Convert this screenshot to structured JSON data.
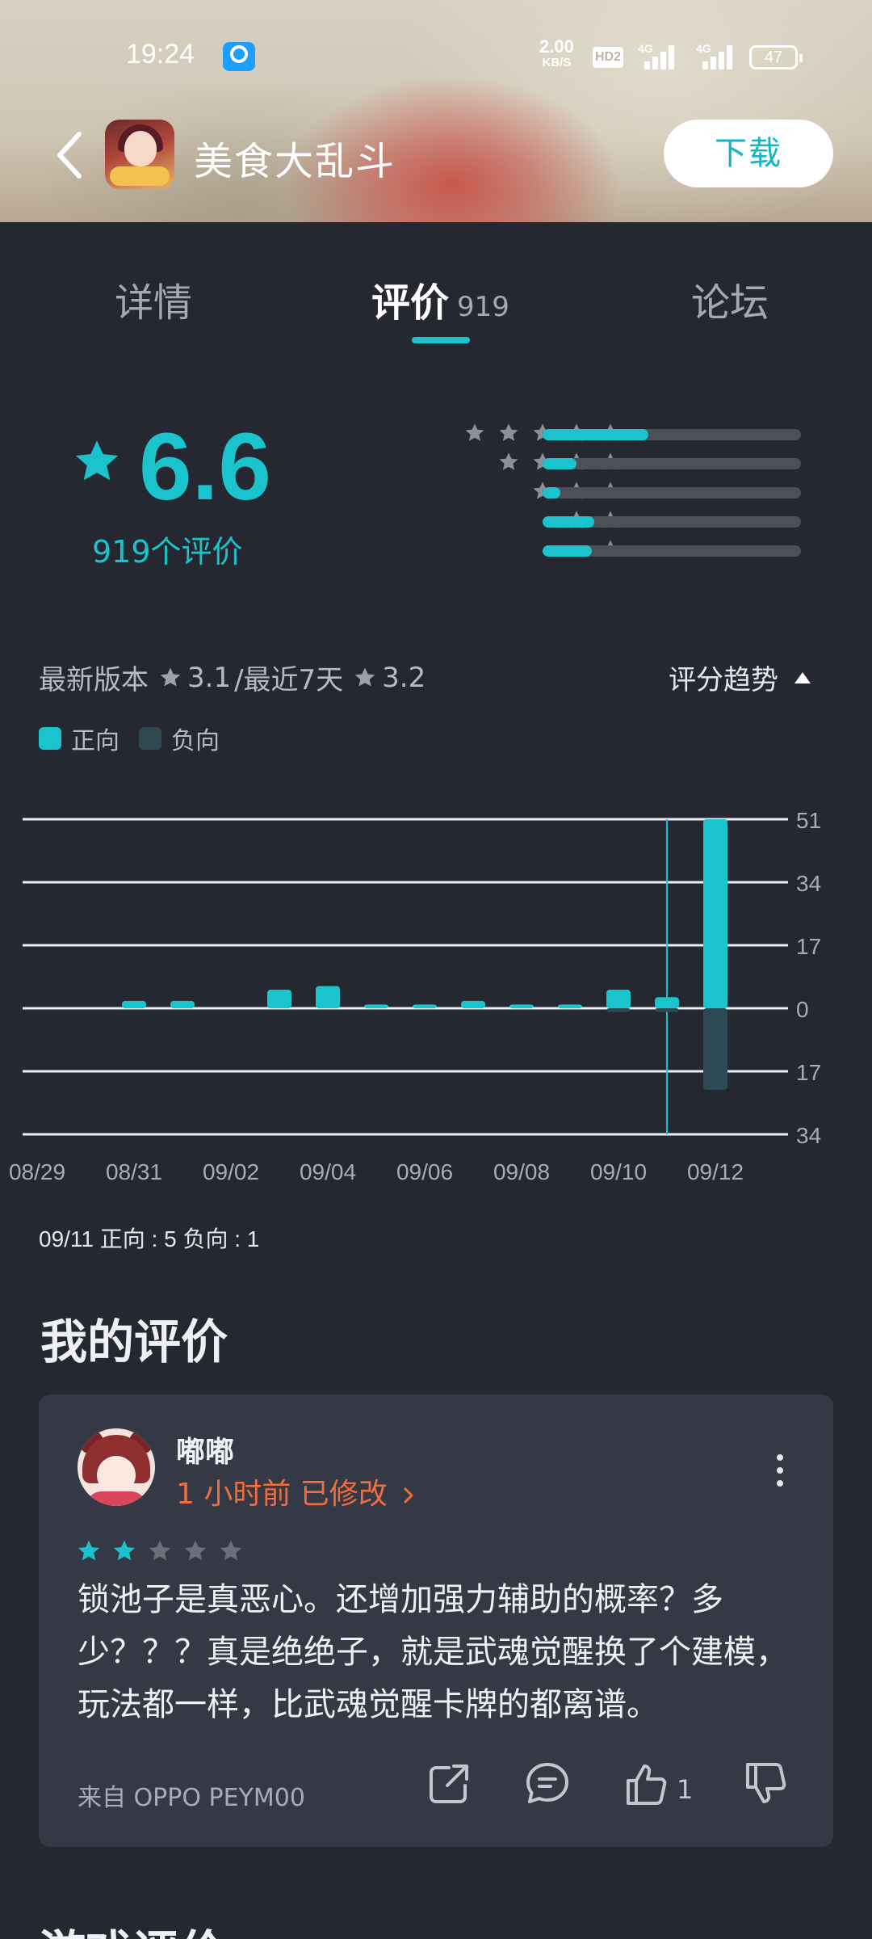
{
  "status_bar": {
    "time": "19:24",
    "speed_value": "2.00",
    "speed_unit": "KB/S",
    "hd_label": "HD2",
    "signal1_label": "4G",
    "signal2_label": "4G",
    "battery": "47"
  },
  "header": {
    "app_title": "美食大乱斗",
    "download_label": "下载"
  },
  "tabs": [
    {
      "label": "详情",
      "count": ""
    },
    {
      "label": "评价",
      "count": "919"
    },
    {
      "label": "论坛",
      "count": ""
    }
  ],
  "rating": {
    "score": "6.6",
    "count_label": "919个评价",
    "distribution": [
      {
        "stars": 5,
        "fraction": 0.41
      },
      {
        "stars": 4,
        "fraction": 0.13
      },
      {
        "stars": 3,
        "fraction": 0.07
      },
      {
        "stars": 2,
        "fraction": 0.2
      },
      {
        "stars": 1,
        "fraction": 0.19
      }
    ]
  },
  "version": {
    "latest_label": "最新版本",
    "latest_score": "3.1",
    "recent_label": "/最近7天",
    "recent_score": "3.2",
    "trend_label": "评分趋势"
  },
  "legend": {
    "positive": "正向",
    "negative": "负向"
  },
  "colors": {
    "accent": "#1bc3cc",
    "negative": "#2a4a52",
    "background": "#262831",
    "card": "#353945",
    "orange": "#ef6d3f"
  },
  "chart_data": {
    "type": "bar",
    "x": [
      "08/29",
      "08/30",
      "08/31",
      "09/01",
      "09/02",
      "09/03",
      "09/04",
      "09/05",
      "09/06",
      "09/07",
      "09/08",
      "09/09",
      "09/10",
      "09/11",
      "09/12",
      "09/13"
    ],
    "x_tick_labels": [
      "08/29",
      "08/31",
      "09/02",
      "09/04",
      "09/06",
      "09/08",
      "09/10",
      "09/12"
    ],
    "series": [
      {
        "name": "正向",
        "values": [
          0,
          0,
          2,
          2,
          0,
          5,
          6,
          1,
          1,
          2,
          1,
          1,
          5,
          3,
          51,
          0
        ]
      },
      {
        "name": "负向",
        "values": [
          0,
          0,
          0,
          0,
          0,
          0,
          0,
          0,
          0,
          0,
          0,
          0,
          1,
          1,
          22,
          0
        ]
      }
    ],
    "y_tick_labels": [
      "51",
      "34",
      "17",
      "0",
      "17",
      "34"
    ],
    "ylim": [
      -34,
      51
    ],
    "grid": true,
    "highlight": "09/11",
    "summary": "09/11 正向 : 5  负向 : 1"
  },
  "my_review": {
    "section_title": "我的评价",
    "username": "嘟嘟",
    "time": "1 小时前 已修改",
    "stars": 2,
    "text": "锁池子是真恶心。还增加强力辅助的概率？多少？？？真是绝绝子，就是武魂觉醒换了个建模，玩法都一样，比武魂觉醒卡牌的都离谱。",
    "device": "来自 OPPO PEYM00",
    "like_count": "1"
  },
  "next_section_title": "游戏评价"
}
